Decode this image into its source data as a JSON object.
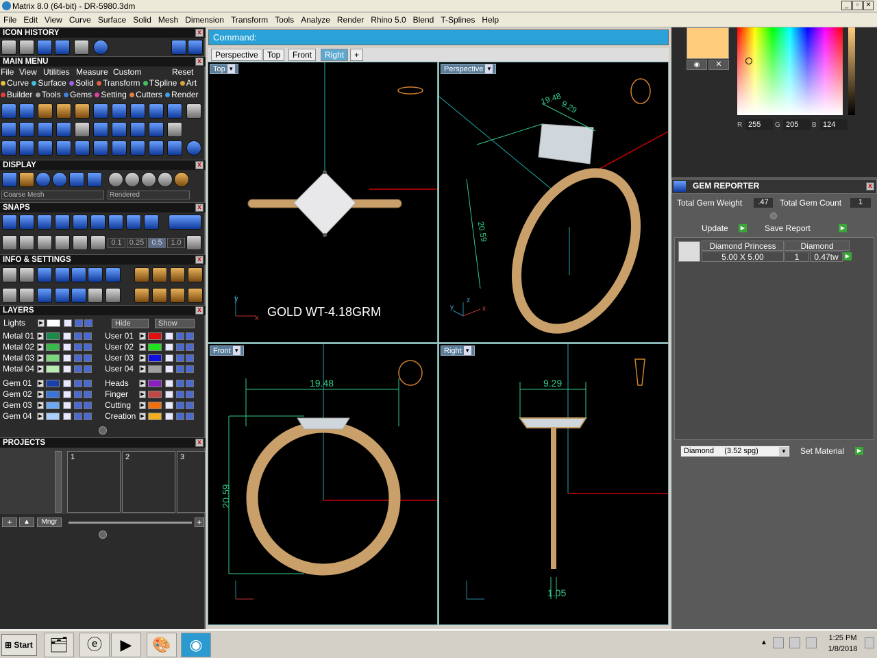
{
  "window": {
    "title": "Matrix 8.0 (64-bit) - DR-5980.3dm"
  },
  "menu": [
    "File",
    "Edit",
    "View",
    "Curve",
    "Surface",
    "Solid",
    "Mesh",
    "Dimension",
    "Transform",
    "Tools",
    "Analyze",
    "Render",
    "Rhino 5.0",
    "Blend",
    "T-Splines",
    "Help"
  ],
  "panels": {
    "icon_history": "ICON HISTORY",
    "main_menu": "MAIN MENU",
    "main_menu_items": [
      "File",
      "View",
      "Utilities",
      "Measure",
      "Custom",
      "Reset"
    ],
    "main_row2": [
      "Curve",
      "Surface",
      "Solid",
      "Transform",
      "TSpline",
      "Art"
    ],
    "main_row3": [
      "Builder",
      "Tools",
      "Gems",
      "Setting",
      "Cutters",
      "Render"
    ],
    "display": "DISPLAY",
    "display_mesh": "Coarse Mesh",
    "display_mode": "Rendered",
    "snaps": "SNAPS",
    "snap_values": [
      "0.1",
      "0.25",
      "0.5",
      "1.0"
    ],
    "info": "INFO & SETTINGS",
    "layers": "LAYERS",
    "lights": "Lights",
    "hide": "Hide",
    "show": "Show",
    "projects": "PROJECTS",
    "project_slots": [
      "1",
      "2",
      "3"
    ],
    "mngr": "Mngr"
  },
  "layers_left": [
    {
      "name": "Metal 01",
      "color": "#1a8a4a"
    },
    {
      "name": "Metal 02",
      "color": "#38b84a"
    },
    {
      "name": "Metal 03",
      "color": "#7ad67a"
    },
    {
      "name": "Metal 04",
      "color": "#b8ecb0"
    },
    {
      "name": "Gem 01",
      "color": "#1b3fa8"
    },
    {
      "name": "Gem 02",
      "color": "#3a74d8"
    },
    {
      "name": "Gem 03",
      "color": "#6ea8f0"
    },
    {
      "name": "Gem 04",
      "color": "#a8d0fa"
    }
  ],
  "layers_right": [
    {
      "name": "User 01",
      "color": "#e01010"
    },
    {
      "name": "User 02",
      "color": "#20e020"
    },
    {
      "name": "User 03",
      "color": "#1010e0"
    },
    {
      "name": "User 04",
      "color": "#a0a0a0"
    },
    {
      "name": "Heads",
      "color": "#8a20c0"
    },
    {
      "name": "Finger",
      "color": "#c04848"
    },
    {
      "name": "Cutting",
      "color": "#f07010"
    },
    {
      "name": "Creation",
      "color": "#f0b020"
    }
  ],
  "command": {
    "label": "Command:"
  },
  "viewport_tabs": [
    "Perspective",
    "Top",
    "Front",
    "Right",
    "+"
  ],
  "viewports": {
    "top": {
      "label": "Top",
      "annotation": "GOLD WT-4.18GRM"
    },
    "perspective": {
      "label": "Perspective",
      "dim1": "19.48",
      "dim2": "9.29",
      "dim3": "20.59"
    },
    "front": {
      "label": "Front",
      "dim_width": "19.48",
      "dim_height": "20.59"
    },
    "right": {
      "label": "Right",
      "dim_width": "9.29",
      "dim_band": "1.05"
    }
  },
  "color_picker": {
    "r": "255",
    "g": "205",
    "b": "124",
    "r_label": "R",
    "g_label": "G",
    "b_label": "B",
    "swatch": "#ffcd7c"
  },
  "gem_reporter": {
    "title": "GEM REPORTER",
    "weight_label": "Total Gem Weight",
    "weight_value": ".47",
    "count_label": "Total Gem Count",
    "count_value": "1",
    "update": "Update",
    "save_report": "Save Report",
    "row": {
      "name": "Diamond Princess",
      "type": "Diamond",
      "size": "5.00 X 5.00",
      "qty": "1",
      "ctw": "0.47tw"
    },
    "material_select": "Diamond     (3.52 spg)",
    "set_material": "Set Material"
  },
  "taskbar": {
    "start": "Start",
    "time": "1:25 PM",
    "date": "1/8/2018"
  }
}
